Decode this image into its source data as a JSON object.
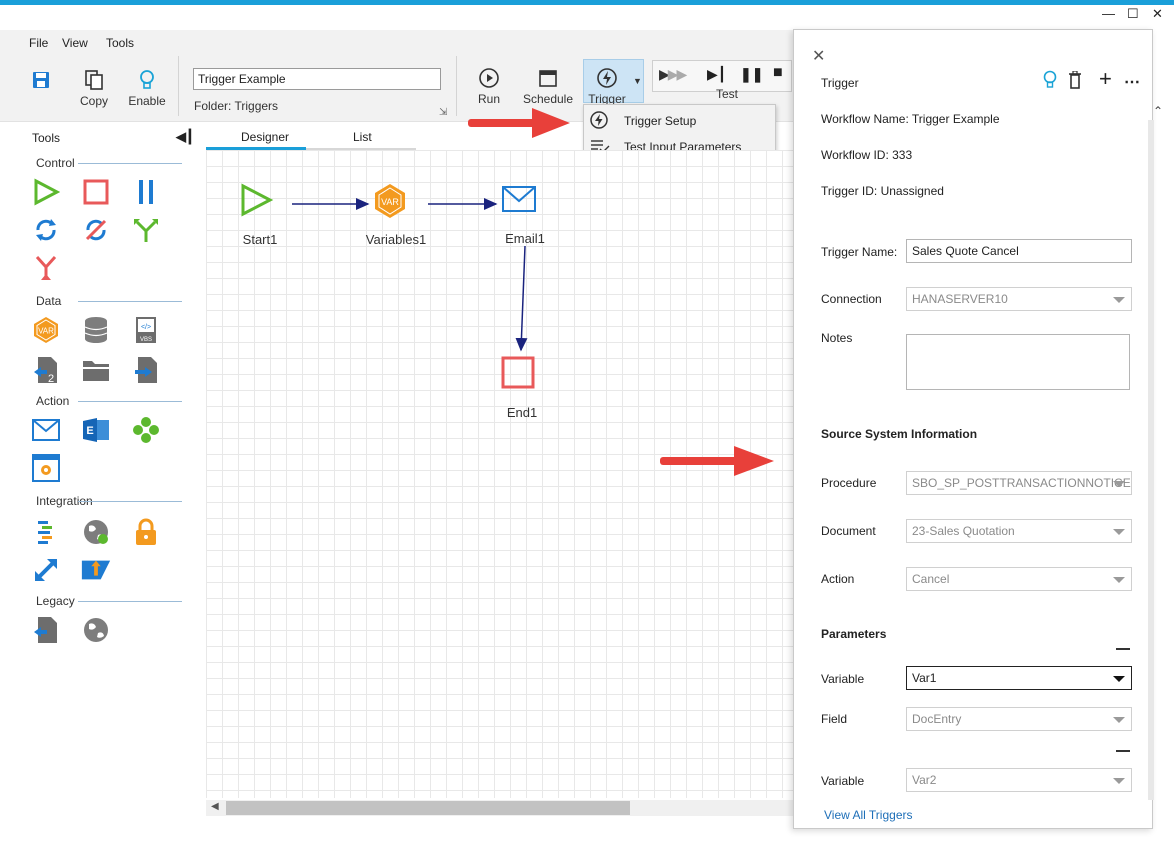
{
  "menu": {
    "file": "File",
    "view": "View",
    "tools": "Tools"
  },
  "ribbon": {
    "copy": "Copy",
    "enable": "Enable",
    "workflow_name_value": "Trigger Example",
    "folder_label": "Folder:",
    "folder_value": "Triggers",
    "run": "Run",
    "schedule": "Schedule",
    "trigger": "Trigger",
    "test": "Test"
  },
  "trigger_menu": {
    "items": [
      {
        "label": "Trigger Setup",
        "icon": "lightning-circle-icon"
      },
      {
        "label": "Test Input Parameters",
        "icon": "list-check-icon"
      }
    ]
  },
  "tools_pane": {
    "title": "Tools",
    "sections": {
      "control": "Control",
      "data": "Data",
      "action": "Action",
      "integration": "Integration",
      "legacy": "Legacy"
    }
  },
  "tabs": {
    "designer": "Designer",
    "list": "List"
  },
  "canvas": {
    "nodes": {
      "start": "Start1",
      "variables": "Variables1",
      "email": "Email1",
      "end": "End1"
    },
    "var_badge": "VAR"
  },
  "panel": {
    "title": "Trigger",
    "workflow_name": "Workflow Name: Trigger Example",
    "workflow_id": "Workflow ID: 333",
    "trigger_id": "Trigger ID: Unassigned",
    "trigger_name_label": "Trigger Name:",
    "trigger_name_value": "Sales Quote Cancel",
    "connection_label": "Connection",
    "connection_value": "HANASERVER10",
    "notes_label": "Notes",
    "source_header": "Source System Information",
    "procedure_label": "Procedure",
    "procedure_value": "SBO_SP_POSTTRANSACTIONNOTICE",
    "document_label": "Document",
    "document_value": "23-Sales Quotation",
    "action_label": "Action",
    "action_value": "Cancel",
    "parameters_header": "Parameters",
    "variable_label_1": "Variable",
    "variable_value_1": "Var1",
    "field_label": "Field",
    "field_value": "DocEntry",
    "variable_label_2": "Variable",
    "variable_value_2": "Var2",
    "view_all": "View All Triggers"
  },
  "colors": {
    "accent": "#1a9fd9",
    "annotation_arrow": "#e8403a",
    "start_green": "#5cb82e",
    "end_red": "#e8595a",
    "var_orange": "#f39a1f",
    "email_blue": "#1e7bd1"
  }
}
